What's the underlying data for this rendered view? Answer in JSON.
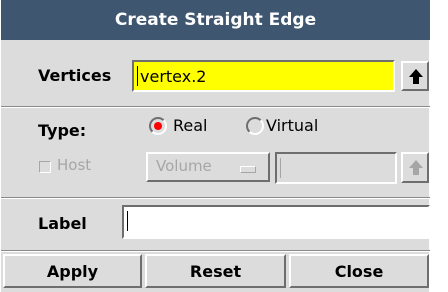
{
  "dialog": {
    "title": "Create Straight Edge",
    "vertices": {
      "label": "Vertices",
      "value": "vertex.2"
    },
    "type": {
      "label": "Type:",
      "options": [
        {
          "label": "Real",
          "selected": true
        },
        {
          "label": "Virtual",
          "selected": false
        }
      ]
    },
    "host": {
      "label": "Host",
      "checked": false,
      "enabled": false,
      "entity_type": "Volume",
      "value": ""
    },
    "label_field": {
      "label": "Label",
      "value": ""
    },
    "buttons": {
      "apply": "Apply",
      "reset": "Reset",
      "close": "Close"
    }
  },
  "colors": {
    "title_bg": "#3f5670",
    "highlight_field": "#ffff00",
    "radio_selected": "#ff0000"
  },
  "icons": {
    "vertices_picker": "up-arrow-icon",
    "host_picker": "up-arrow-icon",
    "dropdown": "option-menu-indicator-icon"
  }
}
